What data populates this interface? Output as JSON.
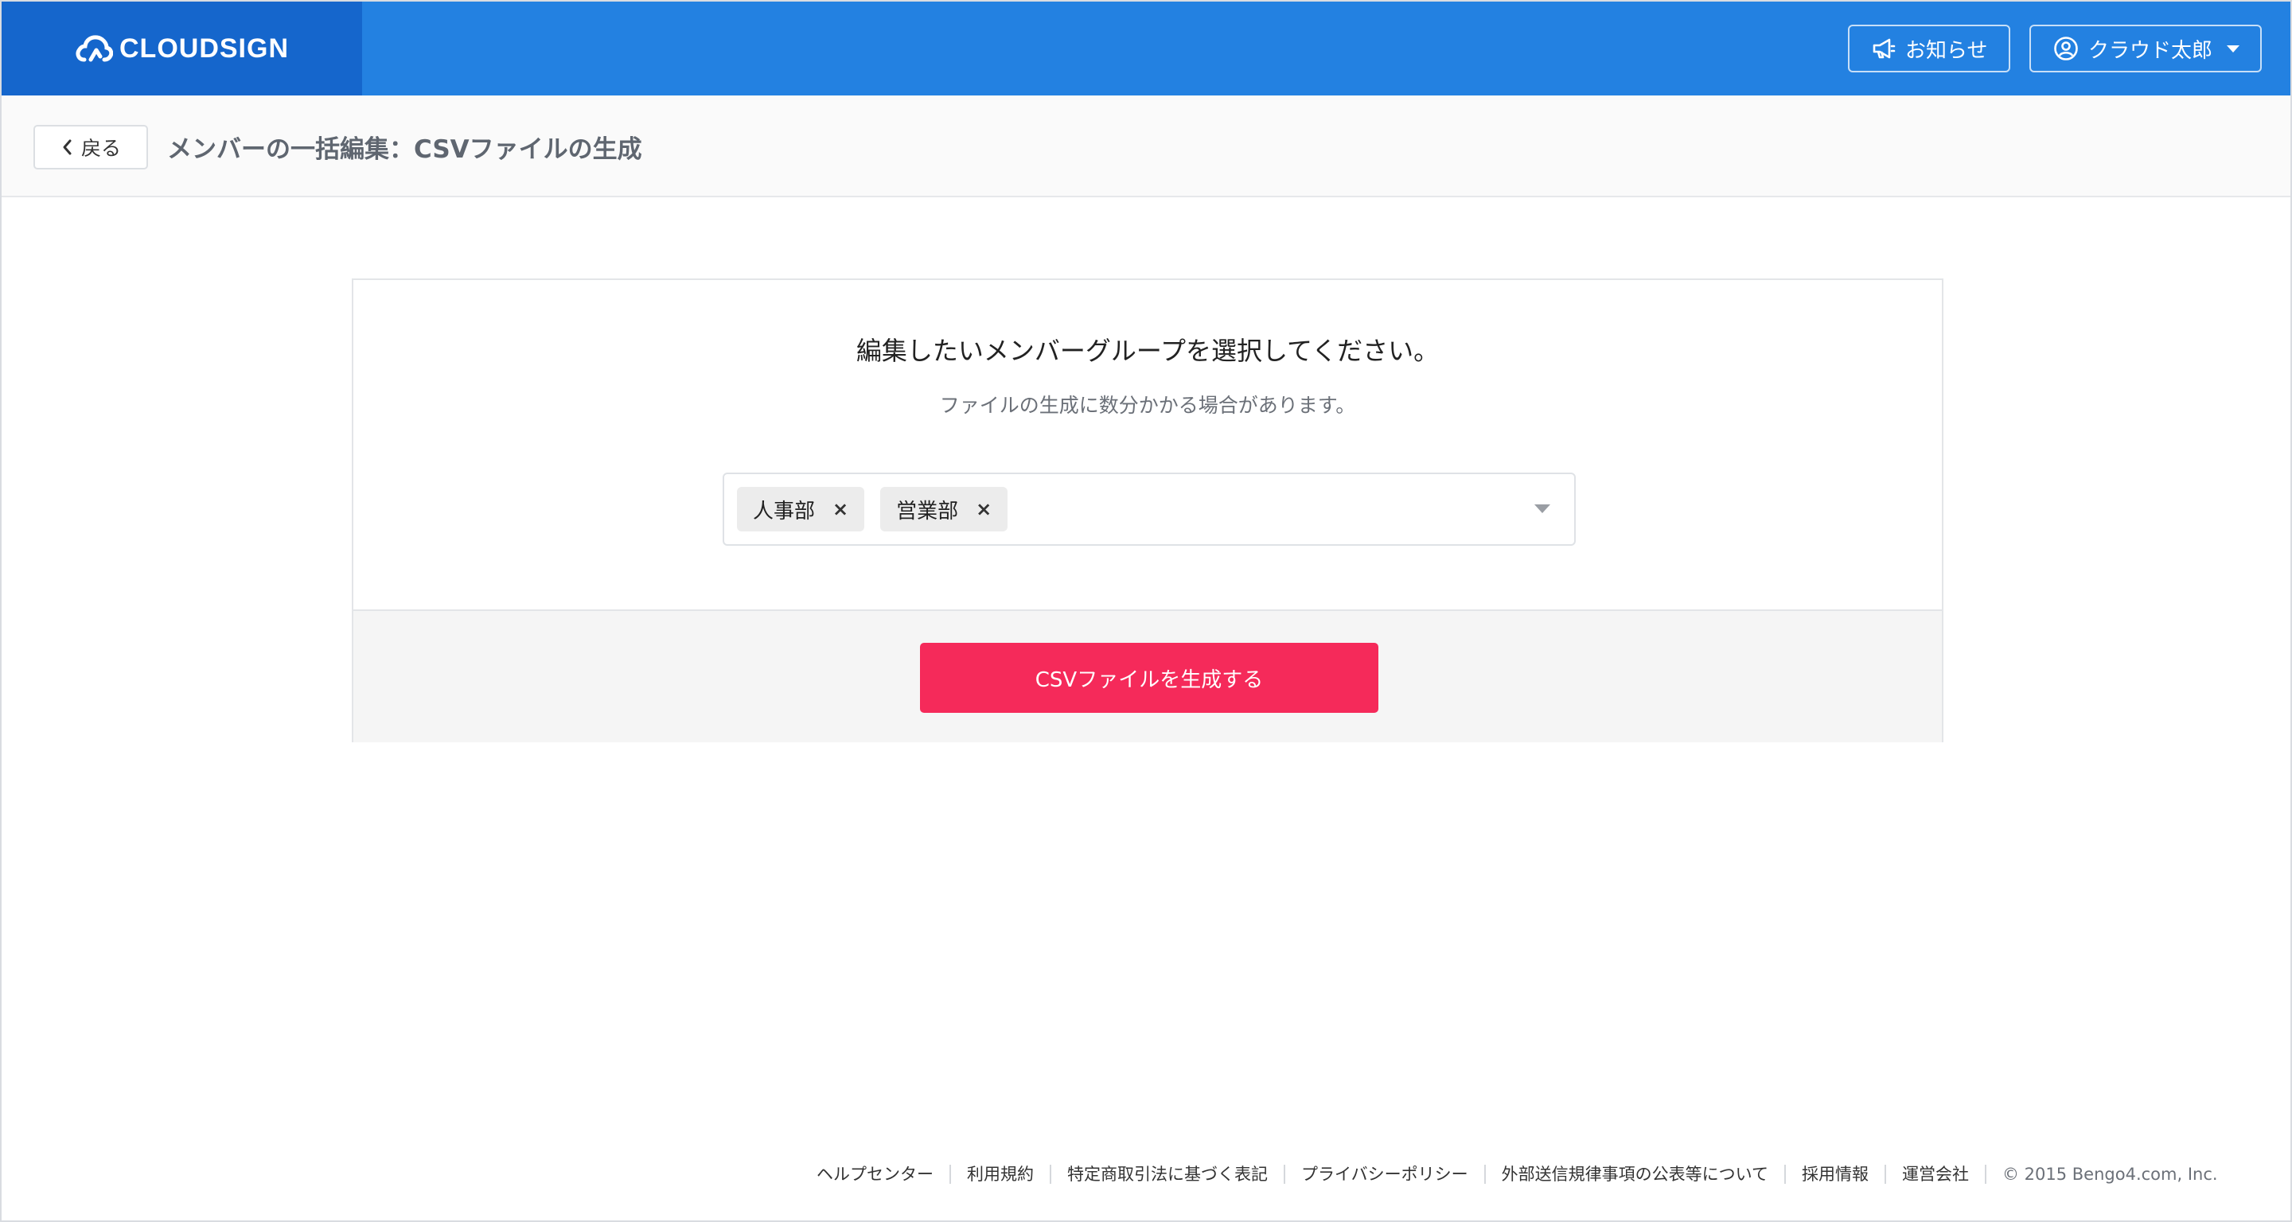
{
  "header": {
    "logo_text": "CLOUDSIGN",
    "news_label": "お知らせ",
    "user_label": "クラウド太郎"
  },
  "subheader": {
    "back_label": "戻る",
    "title": "メンバーの一括編集：CSVファイルの生成"
  },
  "card": {
    "heading": "編集したいメンバーグループを選択してください。",
    "subtext": "ファイルの生成に数分かかる場合があります。",
    "selected_groups": [
      {
        "label": "人事部",
        "remove": "×"
      },
      {
        "label": "営業部",
        "remove": "×"
      }
    ],
    "generate_label": "CSVファイルを生成する"
  },
  "footer": {
    "links": [
      "ヘルプセンター",
      "利用規約",
      "特定商取引法に基づく表記",
      "プライバシーポリシー",
      "外部送信規律事項の公表等について",
      "採用情報",
      "運営会社"
    ],
    "copyright": "© 2015 Bengo4.com, Inc."
  },
  "colors": {
    "header_bg": "#2381e1",
    "logo_bg": "#1566cc",
    "primary_action": "#f52a5a"
  }
}
